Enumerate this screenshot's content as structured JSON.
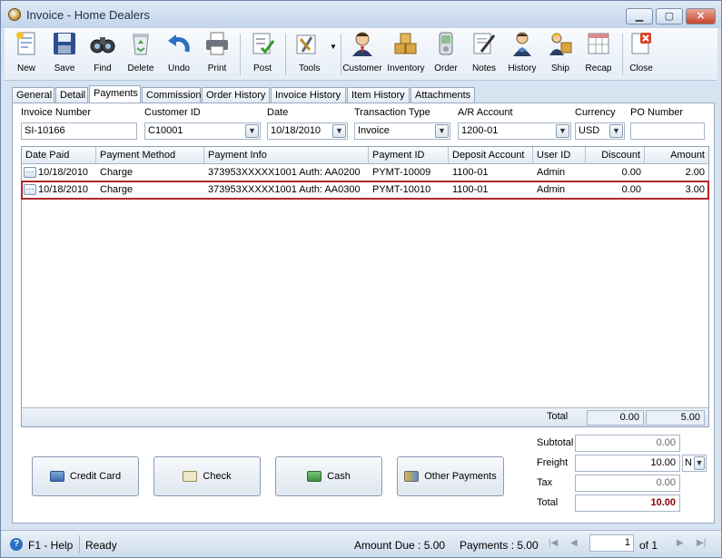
{
  "window": {
    "title": "Invoice - Home Dealers"
  },
  "toolbar": {
    "items": [
      {
        "label": "New",
        "icon": "new-document-icon"
      },
      {
        "label": "Save",
        "icon": "floppy-disk-icon"
      },
      {
        "label": "Find",
        "icon": "binoculars-icon"
      },
      {
        "label": "Delete",
        "icon": "recycle-bin-icon"
      },
      {
        "label": "Undo",
        "icon": "undo-arrow-icon"
      },
      {
        "label": "Print",
        "icon": "printer-icon"
      },
      {
        "label": "Post",
        "icon": "post-checklist-icon"
      },
      {
        "label": "Tools",
        "icon": "tools-icon"
      },
      {
        "label": "Customer",
        "icon": "customer-person-icon"
      },
      {
        "label": "Inventory",
        "icon": "inventory-boxes-icon"
      },
      {
        "label": "Order",
        "icon": "order-device-icon"
      },
      {
        "label": "Notes",
        "icon": "notes-pen-icon"
      },
      {
        "label": "History",
        "icon": "history-person-icon"
      },
      {
        "label": "Ship",
        "icon": "ship-person-icon"
      },
      {
        "label": "Recap",
        "icon": "recap-table-icon"
      },
      {
        "label": "Close",
        "icon": "close-document-icon"
      }
    ]
  },
  "tabs": [
    "General",
    "Detail",
    "Payments",
    "Commission",
    "Order History",
    "Invoice History",
    "Item History",
    "Attachments"
  ],
  "header_fields": {
    "invoice_number": {
      "label": "Invoice Number",
      "value": "SI-10166"
    },
    "customer_id": {
      "label": "Customer ID",
      "value": "C10001"
    },
    "date": {
      "label": "Date",
      "value": "10/18/2010"
    },
    "transaction_type": {
      "label": "Transaction Type",
      "value": "Invoice"
    },
    "ar_account": {
      "label": "A/R Account",
      "value": "1200-01"
    },
    "currency": {
      "label": "Currency",
      "value": "USD"
    },
    "po_number": {
      "label": "PO Number",
      "value": ""
    }
  },
  "grid": {
    "columns": [
      "Date Paid",
      "Payment Method",
      "Payment Info",
      "Payment ID",
      "Deposit Account",
      "User ID",
      "Discount",
      "Amount"
    ],
    "rows": [
      {
        "date_paid": "10/18/2010",
        "method": "Charge",
        "info": "373953XXXXX1001 Auth: AA0200",
        "payment_id": "PYMT-10009",
        "deposit_account": "1100-01",
        "user_id": "Admin",
        "discount": "0.00",
        "amount": "2.00"
      },
      {
        "date_paid": "10/18/2010",
        "method": "Charge",
        "info": "373953XXXXX1001 Auth: AA0300",
        "payment_id": "PYMT-10010",
        "deposit_account": "1100-01",
        "user_id": "Admin",
        "discount": "0.00",
        "amount": "3.00"
      }
    ],
    "total_label": "Total",
    "total_discount": "0.00",
    "total_amount": "5.00"
  },
  "payment_buttons": {
    "credit_card": "Credit Card",
    "check": "Check",
    "cash": "Cash",
    "other": "Other Payments"
  },
  "summary": {
    "subtotal_label": "Subtotal",
    "subtotal": "0.00",
    "freight_label": "Freight",
    "freight": "10.00",
    "freight_option": "N",
    "tax_label": "Tax",
    "tax": "0.00",
    "total_label": "Total",
    "total": "10.00"
  },
  "status": {
    "help": "F1 - Help",
    "state": "Ready",
    "amount_due": "Amount Due : 5.00",
    "payments": "Payments : 5.00",
    "page": "1",
    "of_pages": "of  1"
  },
  "colors": {
    "accent": "#b1262c",
    "total_text": "#8b0000"
  }
}
